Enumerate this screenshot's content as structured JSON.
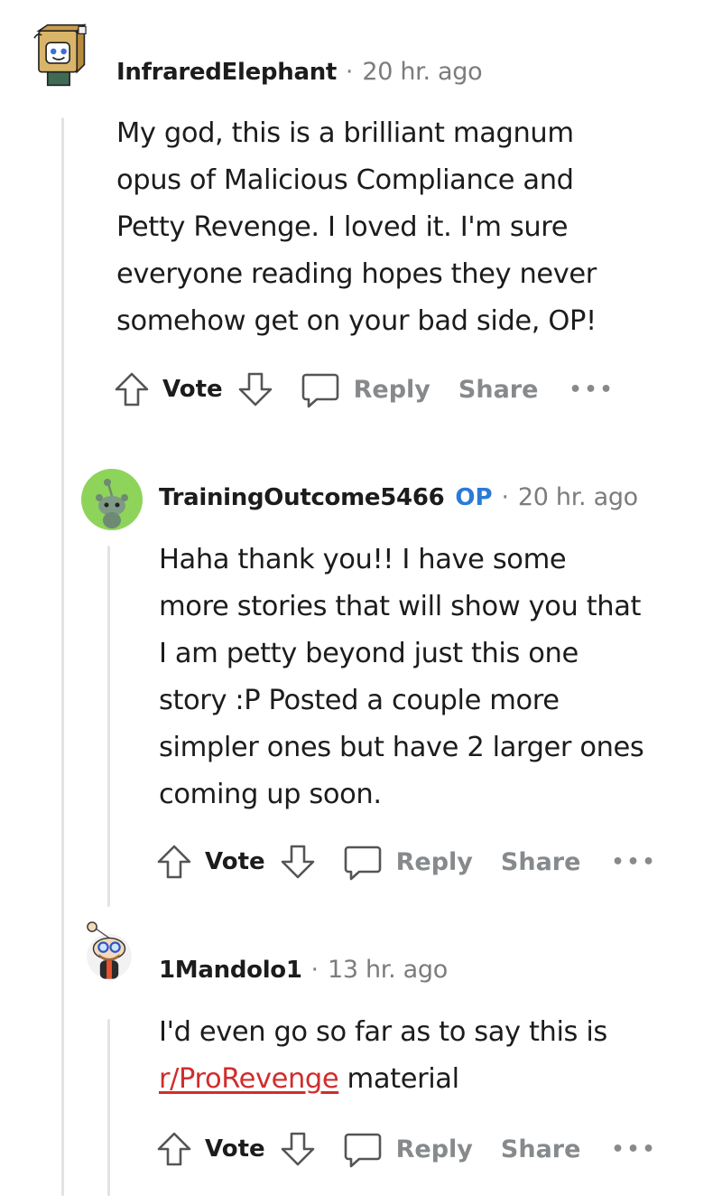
{
  "comments": [
    {
      "author": "InfraredElephant",
      "op_tag": "",
      "separator": "·",
      "time": "20 hr. ago",
      "body_lines": [
        "My god, this is a brilliant magnum",
        "opus of Malicious Compliance and",
        "Petty Revenge. I loved it. I'm sure",
        "everyone reading hopes they never",
        "somehow get on your bad side, OP!"
      ],
      "vote_label": "Vote",
      "reply_label": "Reply",
      "share_label": "Share",
      "more_label": "•••"
    },
    {
      "author": "TrainingOutcome5466",
      "op_tag": "OP",
      "separator": "·",
      "time": "20 hr. ago",
      "body_lines": [
        "Haha thank you!! I have some",
        "more stories that will show you that",
        "I am petty beyond just this one",
        "story :P Posted a couple more",
        "simpler ones but have 2 larger ones",
        "coming up soon."
      ],
      "vote_label": "Vote",
      "reply_label": "Reply",
      "share_label": "Share",
      "more_label": "•••"
    },
    {
      "author": "1Mandolo1",
      "op_tag": "",
      "separator": "·",
      "time": "13 hr. ago",
      "body_line_1": "I'd even go so far as to say this is",
      "link_text": "r/ProRevenge",
      "body_line_2_rest": " material",
      "vote_label": "Vote",
      "reply_label": "Reply",
      "share_label": "Share",
      "more_label": "•••"
    }
  ],
  "colors": {
    "text": "#1c1c1c",
    "meta": "#7c7c7c",
    "action": "#878a8c",
    "op_blue": "#2b7ad6",
    "link_red": "#d02d2d",
    "thread_line": "#e3e3e3",
    "avatar_green": "#8fd45a"
  },
  "icons": [
    "upvote-icon",
    "downvote-icon",
    "reply-bubble-icon",
    "more-icon"
  ]
}
